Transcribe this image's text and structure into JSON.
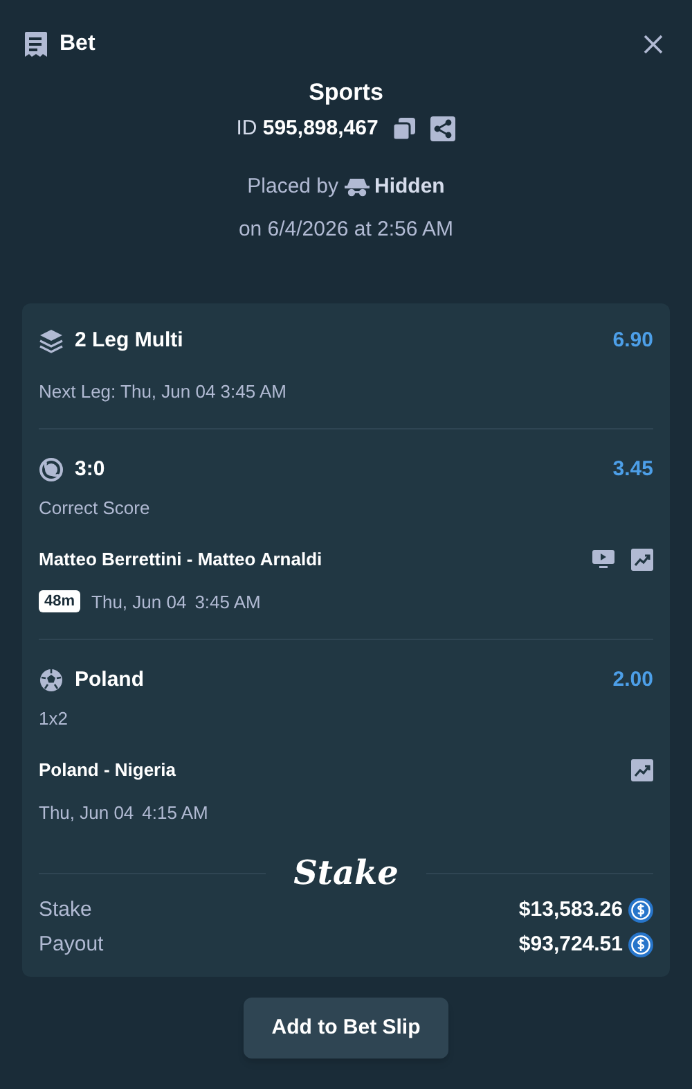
{
  "header": {
    "title": "Bet"
  },
  "summary": {
    "category": "Sports",
    "id_label": "ID",
    "id": "595,898,467",
    "placed_by_label": "Placed by",
    "placed_by": "Hidden",
    "placed_on": "on 6/4/2026 at 2:56 AM"
  },
  "multi": {
    "title": "2 Leg Multi",
    "odds": "6.90",
    "next_leg": "Next Leg: Thu, Jun 04 3:45 AM"
  },
  "legs": [
    {
      "kind": "tennis",
      "selection": "3:0",
      "odds": "3.45",
      "market": "Correct Score",
      "event": "Matteo Berrettini - Matteo Arnaldi",
      "countdown": "48m",
      "date": "Thu, Jun 04",
      "time": "3:45 AM",
      "stream": true,
      "stats": true
    },
    {
      "kind": "soccer",
      "selection": "Poland",
      "odds": "2.00",
      "market": "1x2",
      "event": "Poland - Nigeria",
      "date": "Thu, Jun 04",
      "time": "4:15 AM",
      "stream": false,
      "stats": true
    }
  ],
  "brand": "Stake",
  "totals": [
    {
      "label": "Stake",
      "amount": "$13,583.26"
    },
    {
      "label": "Payout",
      "amount": "$93,724.51"
    }
  ],
  "action": "Add to Bet Slip"
}
